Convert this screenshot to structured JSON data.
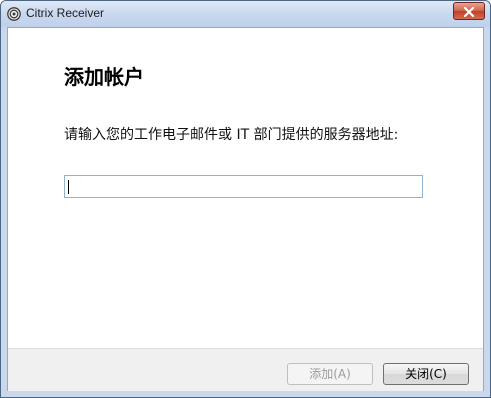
{
  "window": {
    "title": "Citrix Receiver",
    "icon": "citrix-receiver-icon"
  },
  "dialog": {
    "heading": "添加帐户",
    "prompt": "请输入您的工作电子邮件或 IT 部门提供的服务器地址:",
    "input_value": ""
  },
  "buttons": {
    "add_label": "添加(A)",
    "close_label": "关闭(C)"
  },
  "colors": {
    "close_button": "#c2402a",
    "input_border": "#8fb3d0"
  }
}
